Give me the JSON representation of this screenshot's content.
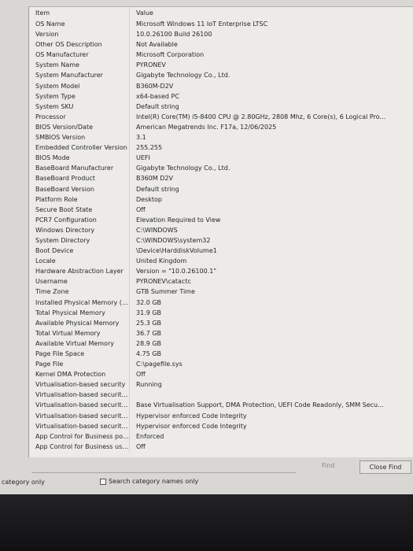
{
  "table": {
    "headers": [
      "Item",
      "Value"
    ],
    "rows": [
      [
        "OS Name",
        "Microsoft Windows 11 IoT Enterprise LTSC"
      ],
      [
        "Version",
        "10.0.26100 Build 26100"
      ],
      [
        "Other OS Description",
        "Not Available"
      ],
      [
        "OS Manufacturer",
        "Microsoft Corporation"
      ],
      [
        "System Name",
        "PYRONEV"
      ],
      [
        "System Manufacturer",
        "Gigabyte Technology Co., Ltd."
      ],
      [
        "System Model",
        "B360M-D2V"
      ],
      [
        "System Type",
        "x64-based PC"
      ],
      [
        "System SKU",
        "Default string"
      ],
      [
        "Processor",
        "Intel(R) Core(TM) i5-8400 CPU @ 2.80GHz, 2808 Mhz, 6 Core(s), 6 Logical Pro..."
      ],
      [
        "BIOS Version/Date",
        "American Megatrends Inc. F17a, 12/06/2025"
      ],
      [
        "SMBIOS Version",
        "3.1"
      ],
      [
        "Embedded Controller Version",
        "255.255"
      ],
      [
        "BIOS Mode",
        "UEFI"
      ],
      [
        "BaseBoard Manufacturer",
        "Gigabyte Technology Co., Ltd."
      ],
      [
        "BaseBoard Product",
        "B360M D2V"
      ],
      [
        "BaseBoard Version",
        "Default string"
      ],
      [
        "Platform Role",
        "Desktop"
      ],
      [
        "Secure Boot State",
        "Off"
      ],
      [
        "PCR7 Configuration",
        "Elevation Required to View"
      ],
      [
        "Windows Directory",
        "C:\\WINDOWS"
      ],
      [
        "System Directory",
        "C:\\WINDOWS\\system32"
      ],
      [
        "Boot Device",
        "\\Device\\HarddiskVolume1"
      ],
      [
        "Locale",
        "United Kingdom"
      ],
      [
        "Hardware Abstraction Layer",
        "Version = \"10.0.26100.1\""
      ],
      [
        "Username",
        "PYRONEV\\catactc"
      ],
      [
        "Time Zone",
        "GTB Summer Time"
      ],
      [
        "Installed Physical Memory (RAM)",
        "32.0 GB"
      ],
      [
        "Total Physical Memory",
        "31.9 GB"
      ],
      [
        "Available Physical Memory",
        "25.3 GB"
      ],
      [
        "Total Virtual Memory",
        "36.7 GB"
      ],
      [
        "Available Virtual Memory",
        "28.9 GB"
      ],
      [
        "Page File Space",
        "4.75 GB"
      ],
      [
        "Page File",
        "C:\\pagefile.sys"
      ],
      [
        "Kernel DMA Protection",
        "Off"
      ],
      [
        "Virtualisation-based security",
        "Running"
      ],
      [
        "Virtualisation-based security re...",
        ""
      ],
      [
        "Virtualisation-based security av...",
        "Base Virtualisation Support, DMA Protection, UEFI Code Readonly, SMM Secu..."
      ],
      [
        "Virtualisation-based security se...",
        "Hypervisor enforced Code Integrity"
      ],
      [
        "Virtualisation-based security se...",
        "Hypervisor enforced Code Integrity"
      ],
      [
        "App Control for Business policy",
        "Enforced"
      ],
      [
        "App Control for Business user ...",
        "Off"
      ]
    ]
  },
  "find": {
    "label": "Find",
    "close_label": "Close Find",
    "search_value": ""
  },
  "options": {
    "left_label": "category only",
    "search_names_label": "Search category names only"
  }
}
